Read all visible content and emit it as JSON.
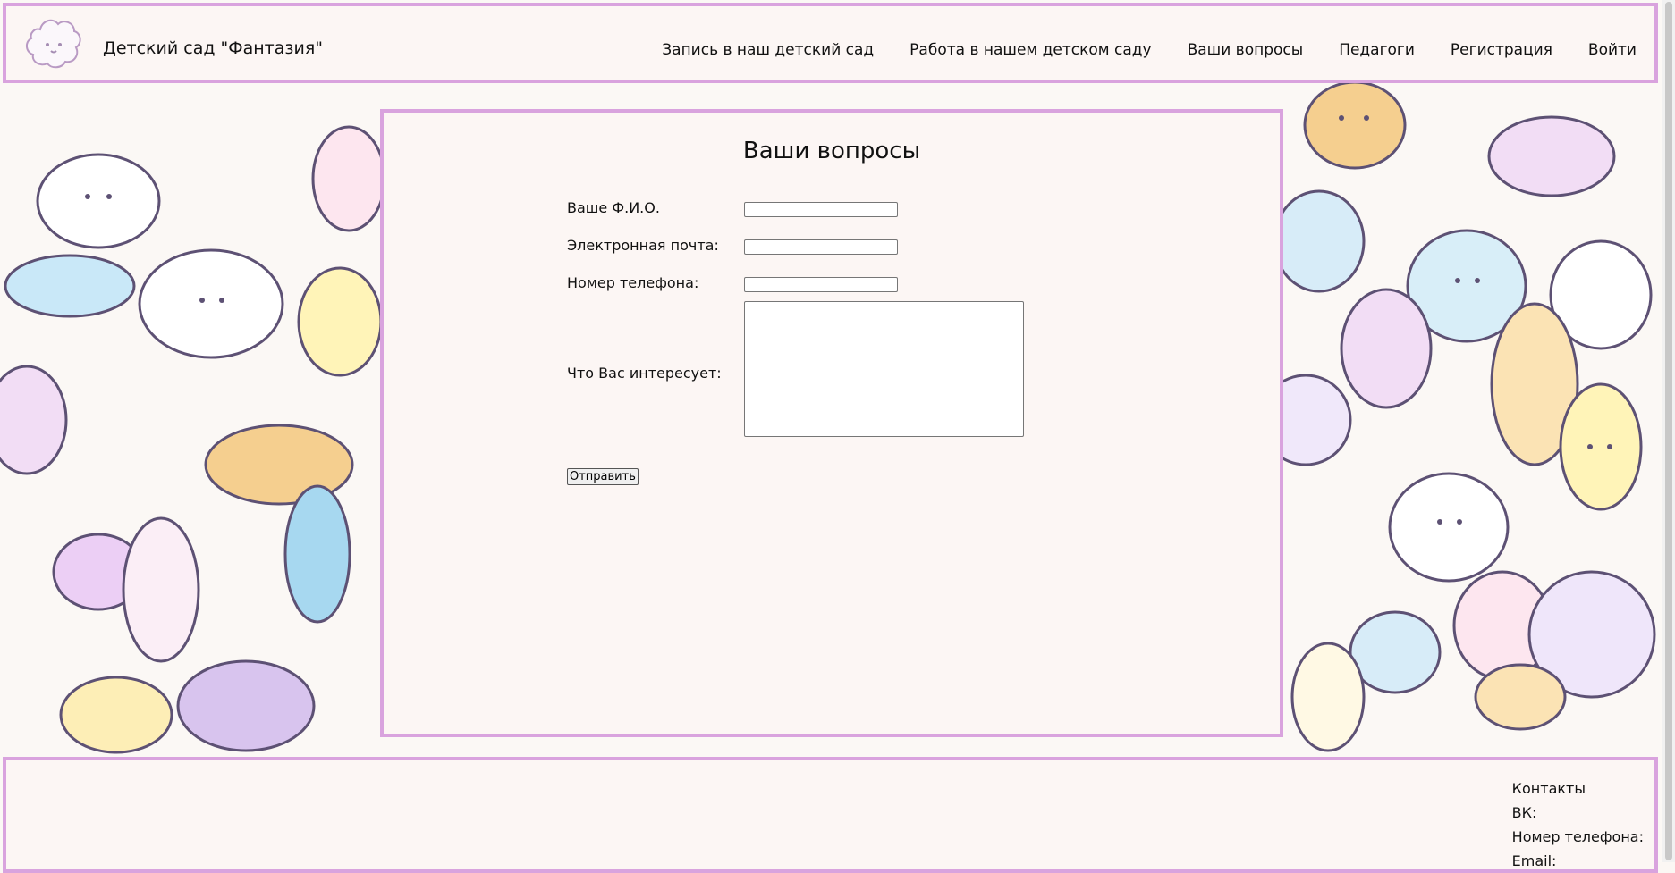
{
  "header": {
    "site_title": "Детский сад \"Фантазия\"",
    "nav": [
      "Запись в наш детский сад",
      "Работа в нашем детском саду",
      "Ваши вопросы",
      "Педагоги",
      "Регистрация",
      "Войти"
    ]
  },
  "form": {
    "title": "Ваши вопросы",
    "fields": {
      "name_label": "Ваше Ф.И.О.",
      "email_label": "Электронная почта:",
      "phone_label": "Номер телефона:",
      "question_label": "Что Вас интересует:"
    },
    "submit_label": "Отправить"
  },
  "footer": {
    "contacts_title": "Контакты",
    "vk_label": "ВК:",
    "phone_label": "Номер телефона:",
    "email_label": "Email:"
  },
  "colors": {
    "border": "#d9a3de",
    "panel": "#fcf6f4"
  }
}
